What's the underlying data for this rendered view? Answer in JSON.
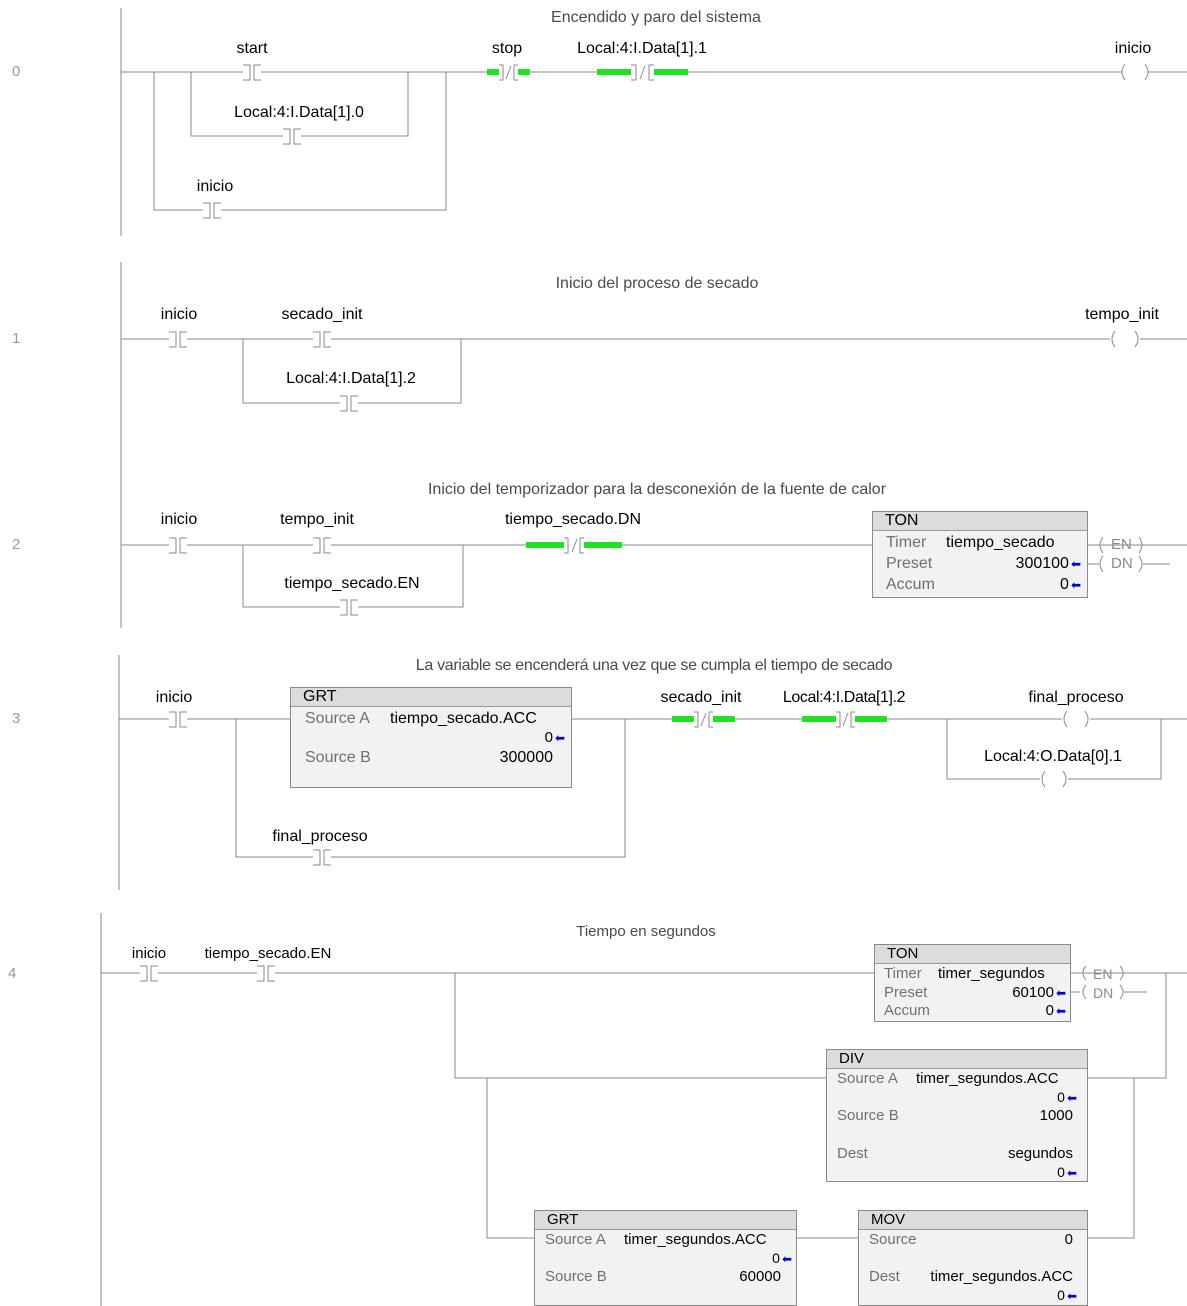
{
  "rungs": [
    {
      "number": "0",
      "comment": "Encendido y paro del sistema",
      "labels": {
        "start": "start",
        "stop": "stop",
        "local_1": "Local:4:I.Data[1].1",
        "local_0": "Local:4:I.Data[1].0",
        "inicio_branch": "inicio",
        "inicio_coil": "inicio"
      }
    },
    {
      "number": "1",
      "comment": "Inicio del proceso de secado",
      "labels": {
        "inicio": "inicio",
        "secado_init": "secado_init",
        "local_2": "Local:4:I.Data[1].2",
        "tempo_init_coil": "tempo_init"
      }
    },
    {
      "number": "2",
      "comment": "Inicio del temporizador para la desconexión de la fuente de calor",
      "labels": {
        "inicio": "inicio",
        "tempo_init": "tempo_init",
        "tiempo_secado_en": "tiempo_secado.EN",
        "tiempo_secado_dn": "tiempo_secado.DN"
      },
      "ton": {
        "title": "TON",
        "timer_label": "Timer",
        "timer_value": "tiempo_secado",
        "preset_label": "Preset",
        "preset_value": "300100",
        "accum_label": "Accum",
        "accum_value": "0",
        "en": "EN",
        "dn": "DN"
      }
    },
    {
      "number": "3",
      "comment": "La variable se encenderá una vez que se cumpla el tiempo de secado",
      "labels": {
        "inicio": "inicio",
        "final_proceso_branch": "final_proceso",
        "secado_init": "secado_init",
        "local_2": "Local:4:I.Data[1].2",
        "final_proceso_coil": "final_proceso",
        "output_coil": "Local:4:O.Data[0].1"
      },
      "grt": {
        "title": "GRT",
        "src_a_label": "Source A",
        "src_a_value": "tiempo_secado.ACC",
        "src_a_live": "0",
        "src_b_label": "Source B",
        "src_b_value": "300000"
      }
    },
    {
      "number": "4",
      "comment": "Tiempo en segundos",
      "labels": {
        "inicio": "inicio",
        "tiempo_secado_en": "tiempo_secado.EN"
      },
      "ton": {
        "title": "TON",
        "timer_label": "Timer",
        "timer_value": "timer_segundos",
        "preset_label": "Preset",
        "preset_value": "60100",
        "accum_label": "Accum",
        "accum_value": "0",
        "en": "EN",
        "dn": "DN"
      },
      "div": {
        "title": "DIV",
        "src_a_label": "Source A",
        "src_a_value": "timer_segundos.ACC",
        "src_a_live": "0",
        "src_b_label": "Source B",
        "src_b_value": "1000",
        "dest_label": "Dest",
        "dest_value": "segundos",
        "dest_live": "0"
      },
      "grt": {
        "title": "GRT",
        "src_a_label": "Source A",
        "src_a_value": "timer_segundos.ACC",
        "src_a_live": "0",
        "src_b_label": "Source B",
        "src_b_value": "60000"
      },
      "mov": {
        "title": "MOV",
        "source_label": "Source",
        "source_value": "0",
        "dest_label": "Dest",
        "dest_value": "timer_segundos.ACC",
        "dest_live": "0"
      }
    }
  ],
  "colors": {
    "power_flow": "#22e022",
    "wire": "#8a8a8a",
    "live_arrow": "#0000cc"
  }
}
